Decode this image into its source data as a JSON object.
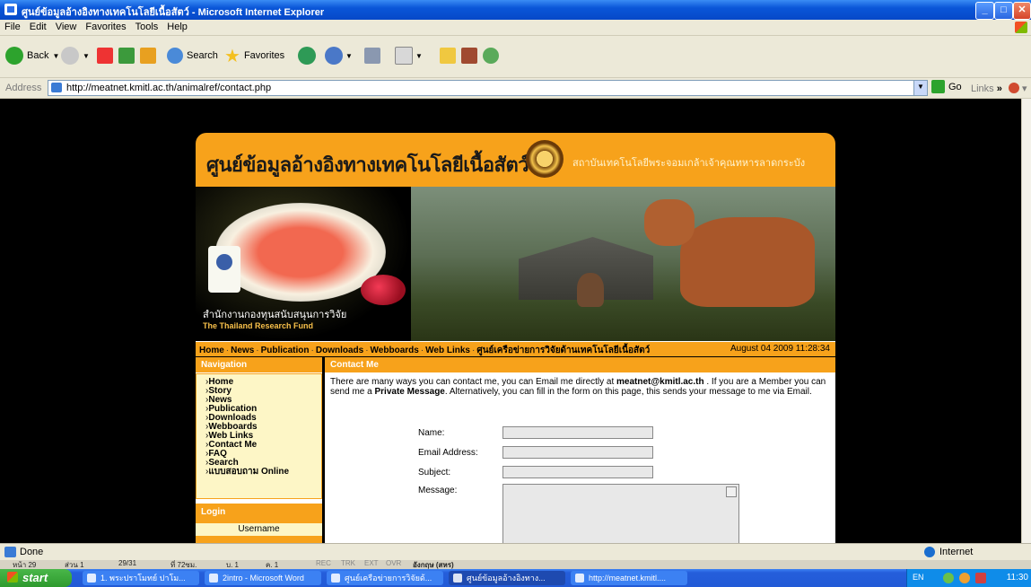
{
  "window": {
    "title": "ศูนย์ข้อมูลอ้างอิงทางเทคโนโลยีเนื้อสัตว์ - Microsoft Internet Explorer"
  },
  "menu": [
    "File",
    "Edit",
    "View",
    "Favorites",
    "Tools",
    "Help"
  ],
  "toolbar": {
    "back_label": "Back",
    "search_label": "Search",
    "favorites_label": "Favorites"
  },
  "address": {
    "label": "Address",
    "url": "http://meatnet.kmitl.ac.th/animalref/contact.php",
    "go_label": "Go",
    "links_label": "Links"
  },
  "site": {
    "title": "ศูนย์ข้อมูลอ้างอิงทางเทคโนโลยีเนื้อสัตว์",
    "institute": "สถาบันเทคโนโลยีพระจอมเกล้าเจ้าคุณทหารลาดกระบัง",
    "trf_thai": "สำนักงานกองทุนสนับสนุนการวิจัย",
    "trf_english": "The Thailand Research Fund",
    "nav_links": [
      "Home",
      "News",
      "Publication",
      "Downloads",
      "Webboards",
      "Web Links",
      "ศูนย์เครือข่ายการวิจัยด้านเทคโนโลยีเนื้อสัตว์"
    ],
    "date": "August 04 2009 11:28:34"
  },
  "sidebar": {
    "nav_title": "Navigation",
    "items": [
      "Home",
      "Story",
      "News",
      "Publication",
      "Downloads",
      "Webboards",
      "Web Links",
      "Contact Me",
      "FAQ",
      "Search",
      "แบบสอบถาม Online"
    ],
    "login_title": "Login",
    "username_label": "Username"
  },
  "contact": {
    "title": "Contact Me",
    "intro_1": "There are many ways you can contact me, you can Email me directly at ",
    "email": "meatnet@kmitl.ac.th",
    "intro_2": " . If you are a Member you can send me a ",
    "private_message": "Private Message",
    "intro_3": ". Alternatively, you can fill in the form on this page, this sends your message to me via Email.",
    "fields": {
      "name": "Name:",
      "email": "Email Address:",
      "subject": "Subject:",
      "message": "Message:"
    }
  },
  "status": {
    "text": "Done",
    "zone": "Internet"
  },
  "ime": [
    "หน้า 29",
    "ส่วน 1",
    "29/31",
    "ที่ 72ซม.",
    "บ. 1",
    "ค. 1",
    "REC",
    "TRK",
    "EXT",
    "OVR",
    "อังกฤษ (สหร)"
  ],
  "taskbar": {
    "start": "start",
    "tasks": [
      "1. พระปราโมทย์ ปาโม...",
      "2intro - Microsoft Word",
      "ศูนย์เครือข่ายการวิจัยด้...",
      "ศูนย์ข้อมูลอ้างอิงทาง...",
      "http://meatnet.kmitl...."
    ],
    "lang": "EN",
    "clock": "11:30"
  }
}
